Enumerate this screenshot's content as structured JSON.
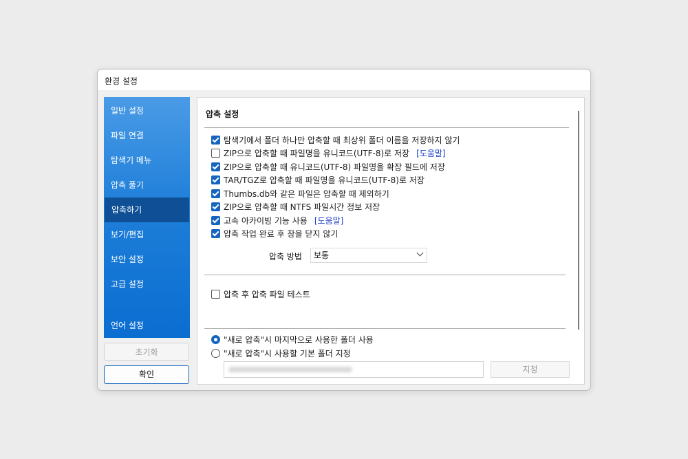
{
  "window": {
    "title": "환경 설정"
  },
  "sidebar": {
    "items": [
      {
        "label": "일반 설정"
      },
      {
        "label": "파일 연결"
      },
      {
        "label": "탐색기 메뉴"
      },
      {
        "label": "압축 풀기"
      },
      {
        "label": "압축하기",
        "active": true
      },
      {
        "label": "보기/편집"
      },
      {
        "label": "보안 설정"
      },
      {
        "label": "고급 설정"
      },
      {
        "label": "언어 설정"
      }
    ],
    "reset_label": "초기화",
    "ok_label": "확인"
  },
  "main": {
    "section_title": "압축 설정",
    "options": [
      {
        "label": "탐색기에서 폴더 하나만 압축할 때 최상위 폴더 이름을 저장하지 않기",
        "checked": true
      },
      {
        "label": "ZIP으로 압축할 때 파일명을 유니코드(UTF-8)로 저장",
        "checked": false,
        "help": "[도움말]"
      },
      {
        "label": "ZIP으로 압축할 때 유니코드(UTF-8) 파일명을 확장 필드에 저장",
        "checked": true
      },
      {
        "label": "TAR/TGZ로 압축할 때 파일명을 유니코드(UTF-8)로 저장",
        "checked": true
      },
      {
        "label": "Thumbs.db와 같은 파일은 압축할 때 제외하기",
        "checked": true
      },
      {
        "label": "ZIP으로 압축할 때 NTFS 파일시간 정보 저장",
        "checked": true
      },
      {
        "label": "고속 아카이빙 기능 사용",
        "checked": true,
        "help": "[도움말]"
      },
      {
        "label": "압축 작업 완료 후 창을 닫지 않기",
        "checked": true
      }
    ],
    "method_label": "압축 방법",
    "method_value": "보통",
    "test_option": {
      "label": "압축 후 압축 파일 테스트",
      "checked": false
    },
    "radio_options": [
      {
        "label": "\"새로 압축\"시 마지막으로 사용한 폴더 사용",
        "selected": true
      },
      {
        "label": "\"새로 압축\"시 사용할 기본 폴더 지정",
        "selected": false
      }
    ],
    "set_button_label": "지정"
  }
}
